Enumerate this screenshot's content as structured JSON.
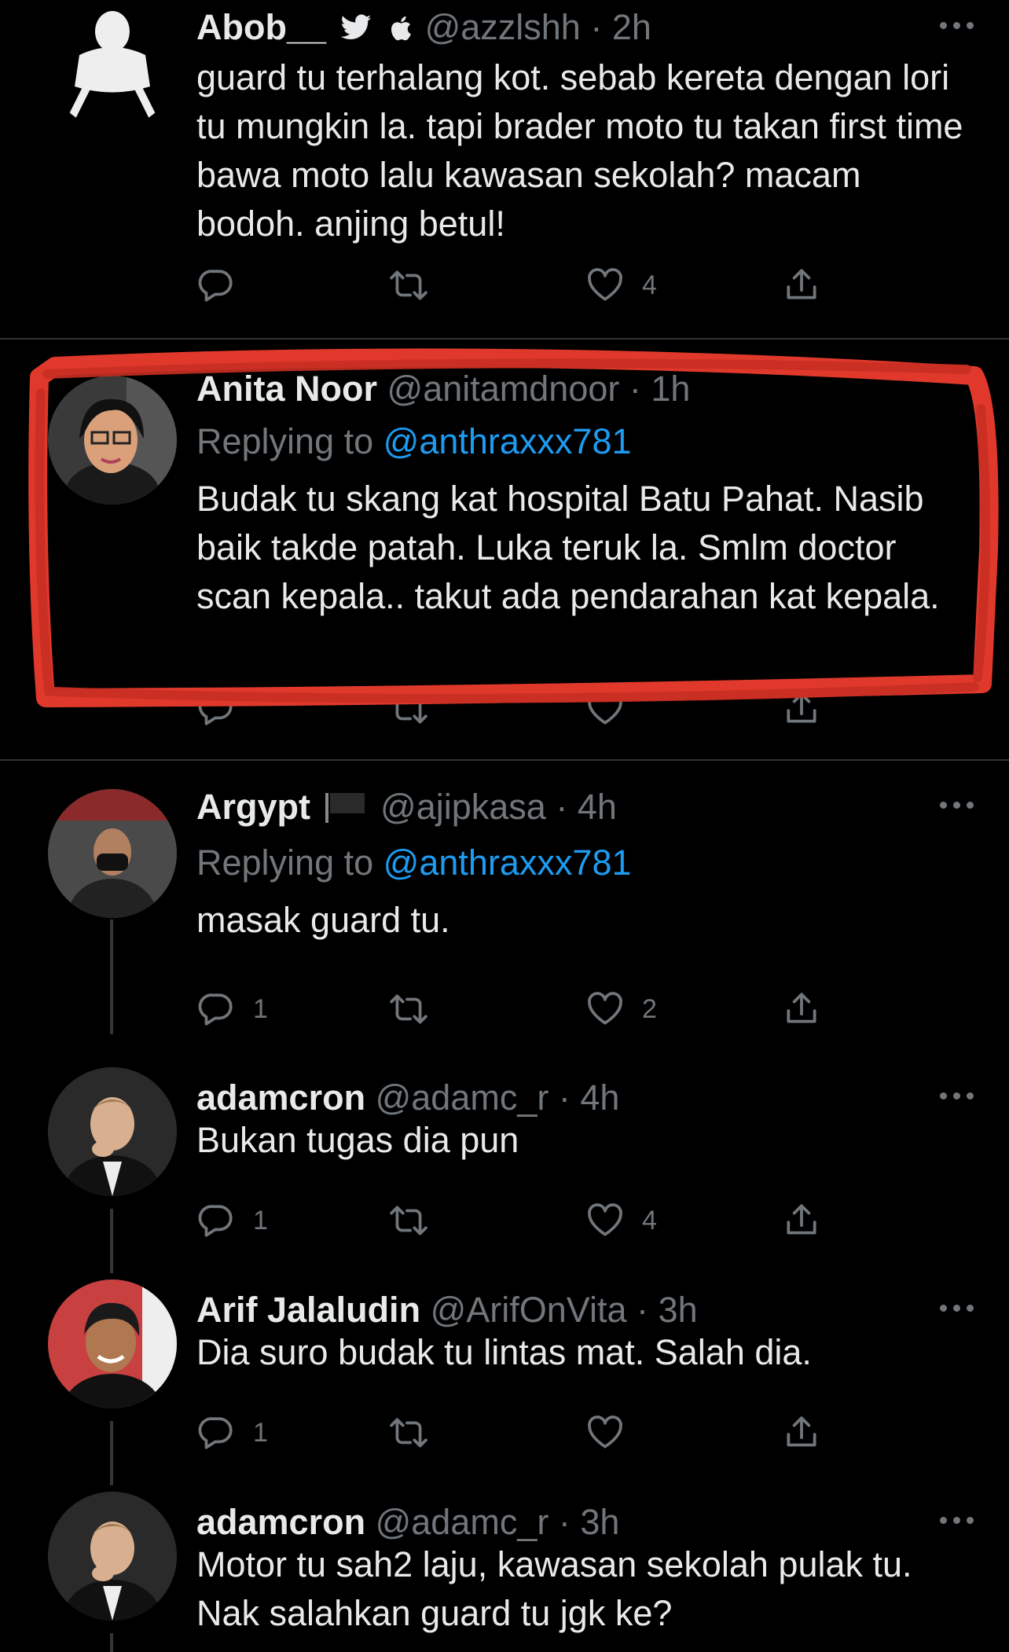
{
  "tweets": [
    {
      "name": "Abob__",
      "handle": "@azzlshh",
      "dot": "·",
      "time": "2h",
      "replying_prefix": "",
      "replying_to": "",
      "text": "guard tu terhalang kot. sebab kereta dengan lori tu mungkin la. tapi brader moto tu takan first time bawa moto lalu kawasan sekolah? macam bodoh. anjing betul!",
      "reply_count": "",
      "retweet_count": "",
      "like_count": "4"
    },
    {
      "name": "Anita Noor",
      "handle": "@anitamdnoor",
      "dot": "·",
      "time": "1h",
      "replying_prefix": "Replying to",
      "replying_to": "@anthraxxx781",
      "text": "Budak tu skang kat hospital Batu Pahat. Nasib baik takde patah. Luka teruk la. Smlm doctor scan kepala.. takut ada pendarahan kat kepala.",
      "reply_count": "",
      "retweet_count": "",
      "like_count": ""
    },
    {
      "name": "Argypt",
      "handle": "@ajipkasa",
      "dot": "·",
      "time": "4h",
      "replying_prefix": "Replying to",
      "replying_to": "@anthraxxx781",
      "text": "masak guard tu.",
      "reply_count": "1",
      "retweet_count": "",
      "like_count": "2"
    },
    {
      "name": "adamcron",
      "handle": "@adamc_r",
      "dot": "·",
      "time": "4h",
      "replying_prefix": "",
      "replying_to": "",
      "text": "Bukan tugas dia pun",
      "reply_count": "1",
      "retweet_count": "",
      "like_count": "4"
    },
    {
      "name": "Arif Jalaludin",
      "handle": "@ArifOnVita",
      "dot": "·",
      "time": "3h",
      "replying_prefix": "",
      "replying_to": "",
      "text": "Dia suro budak tu lintas mat. Salah dia.",
      "reply_count": "1",
      "retweet_count": "",
      "like_count": ""
    },
    {
      "name": "adamcron",
      "handle": "@adamc_r",
      "dot": "·",
      "time": "3h",
      "replying_prefix": "",
      "replying_to": "",
      "text": "Motor tu sah2 laju, kawasan sekolah pulak tu. Nak salahkan guard tu jgk ke?",
      "reply_count": "",
      "retweet_count": "",
      "like_count": ""
    }
  ],
  "colors": {
    "background": "#000000",
    "text": "#e7e9ea",
    "muted": "#71767b",
    "mention": "#1d9bf0",
    "divider": "#2f3336",
    "highlight": "#e0392b"
  },
  "icons": [
    "reply-icon",
    "retweet-icon",
    "like-icon",
    "share-icon",
    "more-icon",
    "twitter-bird-icon",
    "apple-icon",
    "flag-icon"
  ]
}
